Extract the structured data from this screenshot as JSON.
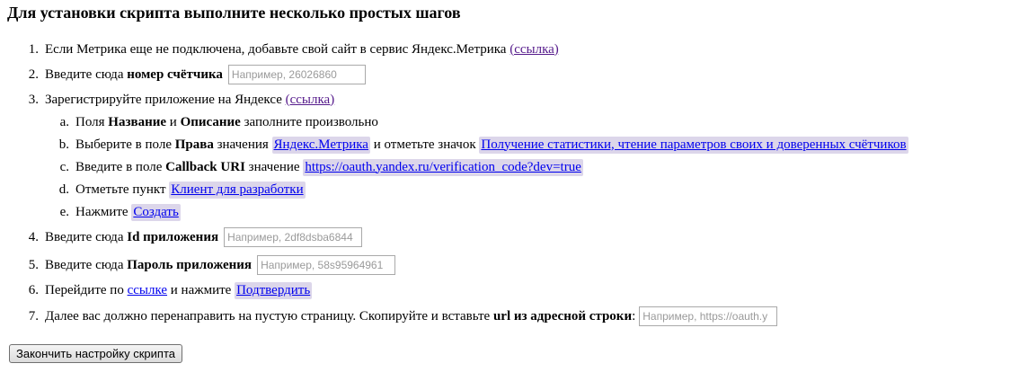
{
  "title": "Для установки скрипта выполните несколько простых шагов",
  "steps": {
    "s1": {
      "num": "1.",
      "text": "Если Метрика еще не подключена, добавьте свой сайт в сервис Яндекс.Метрика",
      "link": "(ссылка)"
    },
    "s2": {
      "num": "2.",
      "text": "Введите сюда",
      "bold": "номер счётчика",
      "placeholder": "Например, 26026860"
    },
    "s3": {
      "num": "3.",
      "text": "Зарегистрируйте приложение на Яндексе",
      "link": "(ссылка)",
      "sub": {
        "a": {
          "num": "a.",
          "pre": "Поля",
          "b1": "Название",
          "mid": "и",
          "b2": "Описание",
          "post": "заполните произвольно"
        },
        "b": {
          "num": "b.",
          "pre": "Выберите в поле",
          "bold": "Права",
          "mid": "значения",
          "link1": "Яндекс.Метрика",
          "mid2": "и отметьте значок",
          "link2": "Получение статистики, чтение параметров своих и доверенных счётчиков"
        },
        "c": {
          "num": "c.",
          "pre": "Введите в поле",
          "bold": "Callback URI",
          "mid": "значение",
          "link": "https://oauth.yandex.ru/verification_code?dev=true"
        },
        "d": {
          "num": "d.",
          "pre": "Отметьте пункт",
          "link": "Клиент для разработки"
        },
        "e": {
          "num": "e.",
          "pre": "Нажмите",
          "link": "Создать"
        }
      }
    },
    "s4": {
      "num": "4.",
      "text": "Введите сюда",
      "bold": "Id приложения",
      "placeholder": "Например, 2df8dsba6844"
    },
    "s5": {
      "num": "5.",
      "text": "Введите сюда",
      "bold": "Пароль приложения",
      "placeholder": "Например, 58s95964961"
    },
    "s6": {
      "num": "6.",
      "pre": "Перейдите по",
      "link1": "ссылке",
      "mid": "и нажмите",
      "link2": "Подтвердить"
    },
    "s7": {
      "num": "7.",
      "text": "Далее вас должно перенаправить на пустую страницу. Скопируйте и вставьте",
      "bold": "url из адресной строки",
      "colon": ":",
      "placeholder": "Например, https://oauth.y"
    }
  },
  "finish_button": "Закончить настройку скрипта"
}
